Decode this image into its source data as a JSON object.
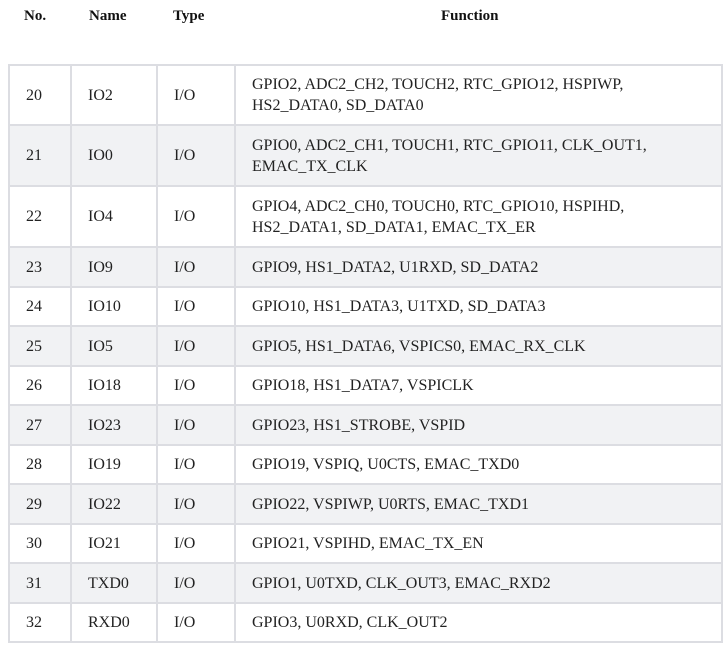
{
  "header": {
    "no": "No.",
    "name": "Name",
    "type": "Type",
    "function": "Function"
  },
  "rows": [
    {
      "no": "20",
      "name": "IO2",
      "type": "I/O",
      "function": "GPIO2, ADC2_CH2, TOUCH2, RTC_GPIO12, HSPIWP, HS2_DATA0, SD_DATA0"
    },
    {
      "no": "21",
      "name": "IO0",
      "type": "I/O",
      "function": "GPIO0, ADC2_CH1, TOUCH1, RTC_GPIO11, CLK_OUT1, EMAC_TX_CLK"
    },
    {
      "no": "22",
      "name": "IO4",
      "type": "I/O",
      "function": "GPIO4, ADC2_CH0, TOUCH0, RTC_GPIO10, HSPIHD, HS2_DATA1, SD_DATA1, EMAC_TX_ER"
    },
    {
      "no": "23",
      "name": "IO9",
      "type": "I/O",
      "function": "GPIO9, HS1_DATA2, U1RXD, SD_DATA2"
    },
    {
      "no": "24",
      "name": "IO10",
      "type": "I/O",
      "function": "GPIO10, HS1_DATA3, U1TXD, SD_DATA3"
    },
    {
      "no": "25",
      "name": "IO5",
      "type": "I/O",
      "function": "GPIO5, HS1_DATA6, VSPICS0, EMAC_RX_CLK"
    },
    {
      "no": "26",
      "name": "IO18",
      "type": "I/O",
      "function": "GPIO18, HS1_DATA7, VSPICLK"
    },
    {
      "no": "27",
      "name": "IO23",
      "type": "I/O",
      "function": "GPIO23, HS1_STROBE, VSPID"
    },
    {
      "no": "28",
      "name": "IO19",
      "type": "I/O",
      "function": "GPIO19, VSPIQ, U0CTS, EMAC_TXD0"
    },
    {
      "no": "29",
      "name": "IO22",
      "type": "I/O",
      "function": "GPIO22, VSPIWP, U0RTS, EMAC_TXD1"
    },
    {
      "no": "30",
      "name": "IO21",
      "type": "I/O",
      "function": "GPIO21, VSPIHD, EMAC_TX_EN"
    },
    {
      "no": "31",
      "name": "TXD0",
      "type": "I/O",
      "function": "GPIO1, U0TXD, CLK_OUT3, EMAC_RXD2"
    },
    {
      "no": "32",
      "name": "RXD0",
      "type": "I/O",
      "function": "GPIO3, U0RXD, CLK_OUT2"
    }
  ]
}
